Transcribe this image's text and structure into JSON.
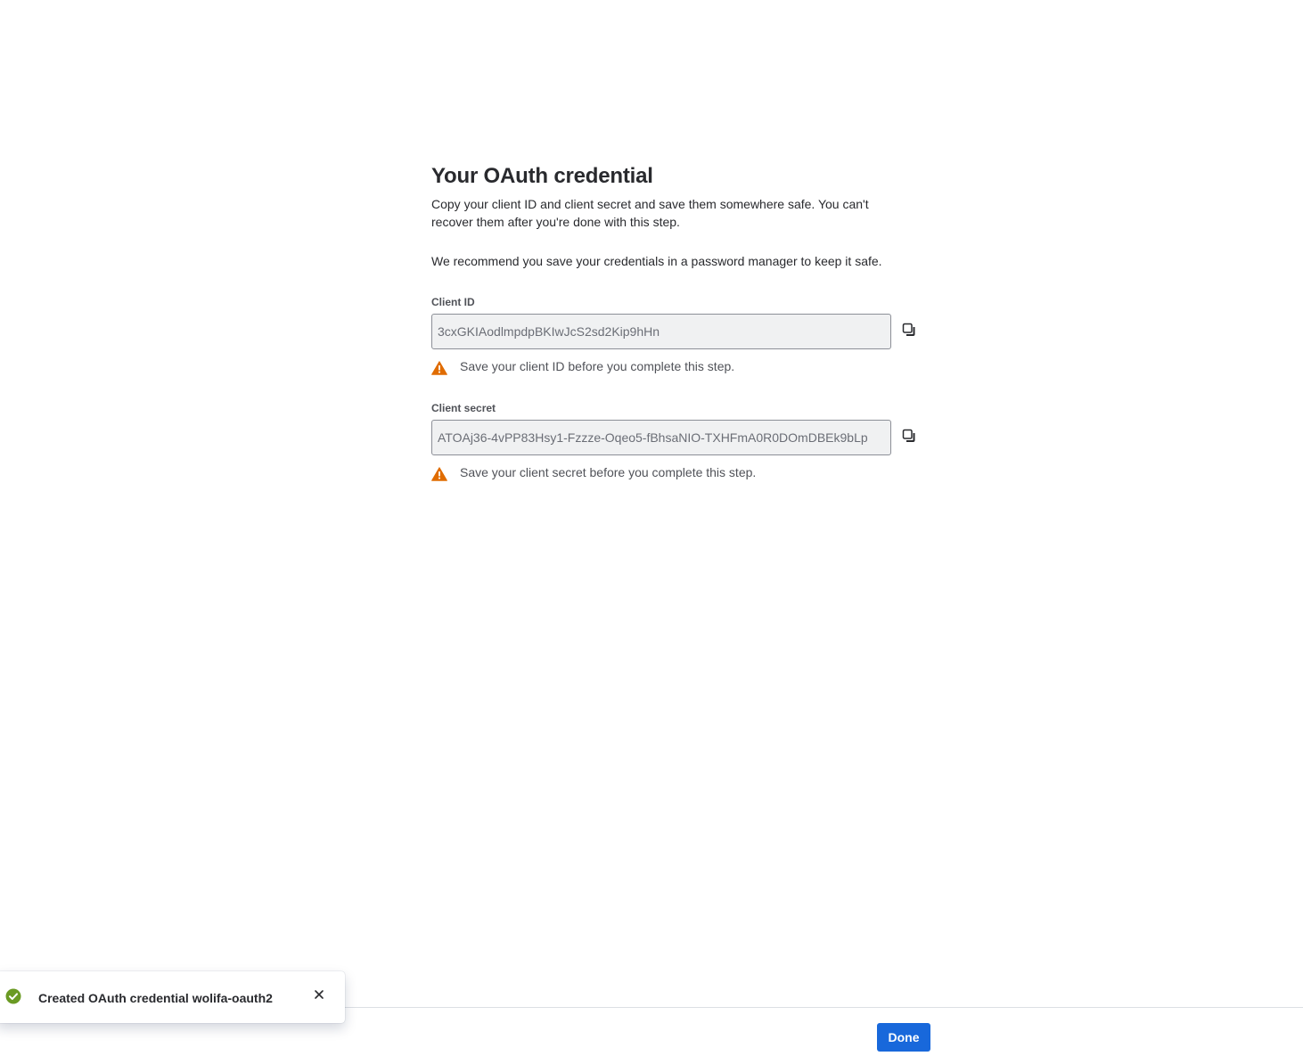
{
  "page": {
    "title": "Your OAuth credential",
    "description": "Copy your client ID and client secret and save them somewhere safe. You can't recover them after you're done with this step.",
    "recommendation": "We recommend you save your credentials in a password manager to keep it safe."
  },
  "client_id": {
    "label": "Client ID",
    "value": "3cxGKIAodlmpdpBKIwJcS2sd2Kip9hHn",
    "warning": "Save your client ID before you complete this step.",
    "copy_icon": "copy-icon",
    "warning_icon": "warning-icon"
  },
  "client_secret": {
    "label": "Client secret",
    "value": "ATOAj36-4vPP83Hsy1-Fzzze-Oqeo5-fBhsaNIO-TXHFmA0R0DOmDBEk9bLp",
    "warning": "Save your client secret before you complete this step.",
    "copy_icon": "copy-icon",
    "warning_icon": "warning-icon"
  },
  "footer": {
    "done_label": "Done"
  },
  "toast": {
    "message": "Created OAuth credential wolifa-oauth2",
    "status_icon": "success-check-icon",
    "close_icon": "close-icon"
  },
  "colors": {
    "primary": "#1868db",
    "warning": "#e06c00",
    "success": "#6a9a23",
    "text": "#292a2e",
    "input_bg": "#f0f1f2"
  }
}
